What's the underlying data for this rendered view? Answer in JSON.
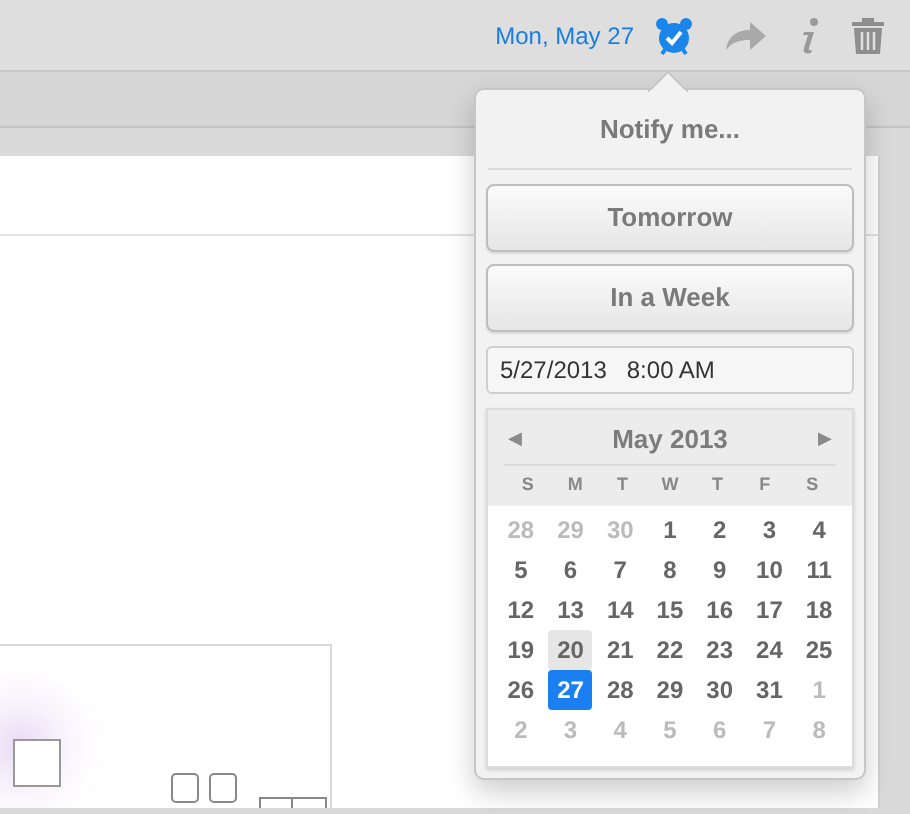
{
  "toolbar": {
    "date": "Mon, May 27",
    "reminder_active": true
  },
  "popover": {
    "title": "Notify me...",
    "buttons": [
      "Tomorrow",
      "In a Week"
    ],
    "datetime": {
      "value": "5/27/2013   8:00 AM"
    },
    "calendar": {
      "prev": "◀",
      "next": "▶",
      "month": "May 2013",
      "weekdays": [
        "S",
        "M",
        "T",
        "W",
        "T",
        "F",
        "S"
      ],
      "weeks": [
        [
          {
            "text": "28",
            "muted": true,
            "selected": false,
            "highlighted": false
          },
          {
            "text": "29",
            "muted": true,
            "selected": false,
            "highlighted": false
          },
          {
            "text": "30",
            "muted": true,
            "selected": false,
            "highlighted": false
          },
          {
            "text": "1",
            "muted": false,
            "selected": false,
            "highlighted": false
          },
          {
            "text": "2",
            "muted": false,
            "selected": false,
            "highlighted": false
          },
          {
            "text": "3",
            "muted": false,
            "selected": false,
            "highlighted": false
          },
          {
            "text": "4",
            "muted": false,
            "selected": false,
            "highlighted": false
          }
        ],
        [
          {
            "text": "5",
            "muted": false,
            "selected": false,
            "highlighted": false
          },
          {
            "text": "6",
            "muted": false,
            "selected": false,
            "highlighted": false
          },
          {
            "text": "7",
            "muted": false,
            "selected": false,
            "highlighted": false
          },
          {
            "text": "8",
            "muted": false,
            "selected": false,
            "highlighted": false
          },
          {
            "text": "9",
            "muted": false,
            "selected": false,
            "highlighted": false
          },
          {
            "text": "10",
            "muted": false,
            "selected": false,
            "highlighted": false
          },
          {
            "text": "11",
            "muted": false,
            "selected": false,
            "highlighted": false
          }
        ],
        [
          {
            "text": "12",
            "muted": false,
            "selected": false,
            "highlighted": false
          },
          {
            "text": "13",
            "muted": false,
            "selected": false,
            "highlighted": false
          },
          {
            "text": "14",
            "muted": false,
            "selected": false,
            "highlighted": false
          },
          {
            "text": "15",
            "muted": false,
            "selected": false,
            "highlighted": false
          },
          {
            "text": "16",
            "muted": false,
            "selected": false,
            "highlighted": false
          },
          {
            "text": "17",
            "muted": false,
            "selected": false,
            "highlighted": false
          },
          {
            "text": "18",
            "muted": false,
            "selected": false,
            "highlighted": false
          }
        ],
        [
          {
            "text": "19",
            "muted": false,
            "selected": false,
            "highlighted": false
          },
          {
            "text": "20",
            "muted": false,
            "selected": false,
            "highlighted": true
          },
          {
            "text": "21",
            "muted": false,
            "selected": false,
            "highlighted": false
          },
          {
            "text": "22",
            "muted": false,
            "selected": false,
            "highlighted": false
          },
          {
            "text": "23",
            "muted": false,
            "selected": false,
            "highlighted": false
          },
          {
            "text": "24",
            "muted": false,
            "selected": false,
            "highlighted": false
          },
          {
            "text": "25",
            "muted": false,
            "selected": false,
            "highlighted": false
          }
        ],
        [
          {
            "text": "26",
            "muted": false,
            "selected": false,
            "highlighted": false
          },
          {
            "text": "27",
            "muted": false,
            "selected": true,
            "highlighted": false
          },
          {
            "text": "28",
            "muted": false,
            "selected": false,
            "highlighted": false
          },
          {
            "text": "29",
            "muted": false,
            "selected": false,
            "highlighted": false
          },
          {
            "text": "30",
            "muted": false,
            "selected": false,
            "highlighted": false
          },
          {
            "text": "31",
            "muted": false,
            "selected": false,
            "highlighted": false
          },
          {
            "text": "1",
            "muted": true,
            "selected": false,
            "highlighted": false
          }
        ],
        [
          {
            "text": "2",
            "muted": true,
            "selected": false,
            "highlighted": false
          },
          {
            "text": "3",
            "muted": true,
            "selected": false,
            "highlighted": false
          },
          {
            "text": "4",
            "muted": true,
            "selected": false,
            "highlighted": false
          },
          {
            "text": "5",
            "muted": true,
            "selected": false,
            "highlighted": false
          },
          {
            "text": "6",
            "muted": true,
            "selected": false,
            "highlighted": false
          },
          {
            "text": "7",
            "muted": true,
            "selected": false,
            "highlighted": false
          },
          {
            "text": "8",
            "muted": true,
            "selected": false,
            "highlighted": false
          }
        ]
      ]
    }
  }
}
